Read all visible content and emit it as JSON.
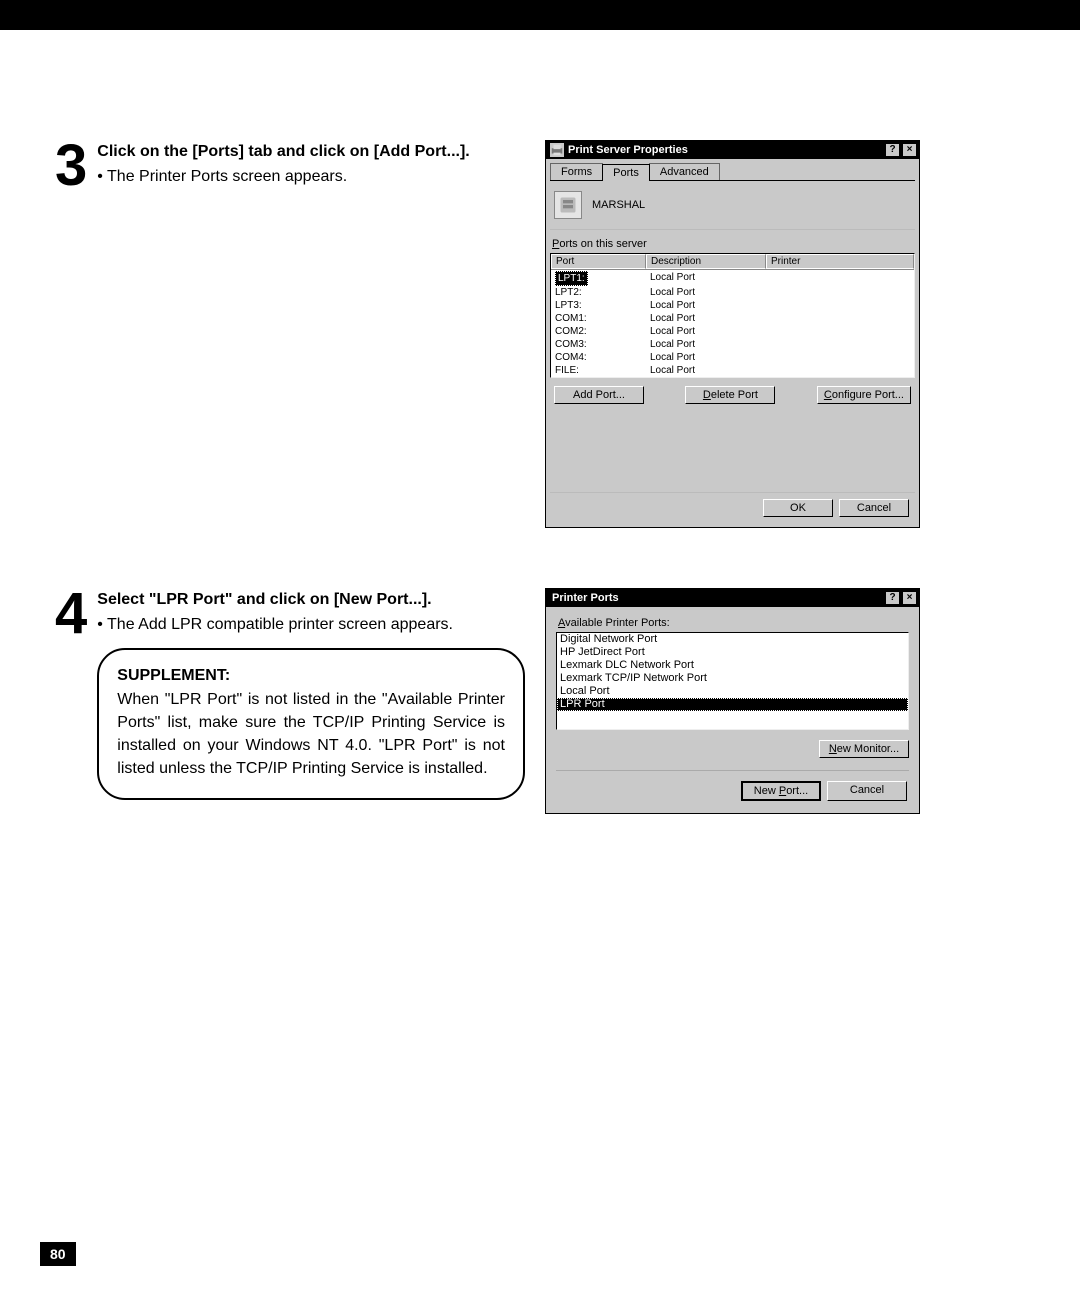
{
  "page_number": "80",
  "step3": {
    "number": "3",
    "title": "Click on the [Ports] tab and click on [Add Port...].",
    "bullet": "The Printer Ports screen appears."
  },
  "step4": {
    "number": "4",
    "title": "Select \"LPR Port\" and click on [New Port...].",
    "bullet": "The Add LPR compatible printer screen appears.",
    "supplement_title": "SUPPLEMENT:",
    "supplement_body": "When \"LPR Port\" is not listed in the \"Available Printer Ports\" list, make sure the TCP/IP Printing Service is installed on your Windows NT 4.0.  \"LPR Port\" is not listed unless the TCP/IP Printing Service is installed."
  },
  "dialog_server": {
    "title": "Print Server Properties",
    "help_btn": "?",
    "close_btn": "×",
    "tabs": {
      "forms": "Forms",
      "ports": "Ports",
      "advanced": "Advanced"
    },
    "server_name": "MARSHAL",
    "list_label_pre": "P",
    "list_label_rest": "orts on this server",
    "col_port": "Port",
    "col_desc": "Description",
    "col_printer": "Printer",
    "rows": [
      {
        "port": "LPT1:",
        "desc": "Local Port",
        "printer": "",
        "selected": true
      },
      {
        "port": "LPT2:",
        "desc": "Local Port",
        "printer": ""
      },
      {
        "port": "LPT3:",
        "desc": "Local Port",
        "printer": ""
      },
      {
        "port": "COM1:",
        "desc": "Local Port",
        "printer": ""
      },
      {
        "port": "COM2:",
        "desc": "Local Port",
        "printer": ""
      },
      {
        "port": "COM3:",
        "desc": "Local Port",
        "printer": ""
      },
      {
        "port": "COM4:",
        "desc": "Local Port",
        "printer": ""
      },
      {
        "port": "FILE:",
        "desc": "Local Port",
        "printer": ""
      }
    ],
    "add_port_btn": "Add Port...",
    "delete_port_btn_pre": "D",
    "delete_port_btn_post": "elete Port",
    "configure_port_btn_pre": "C",
    "configure_port_btn_post": "onfigure Port...",
    "ok_btn": "OK",
    "cancel_btn": "Cancel"
  },
  "dialog_printerports": {
    "title": "Printer Ports",
    "help_btn": "?",
    "close_btn": "×",
    "label_pre": "A",
    "label_rest": "vailable Printer Ports:",
    "items": [
      {
        "text": "Digital Network Port"
      },
      {
        "text": "HP JetDirect Port"
      },
      {
        "text": "Lexmark DLC Network Port"
      },
      {
        "text": "Lexmark TCP/IP Network Port"
      },
      {
        "text": "Local Port"
      },
      {
        "text": "LPR Port",
        "selected": true
      }
    ],
    "new_monitor_btn_pre": "N",
    "new_monitor_btn_post": "ew Monitor...",
    "new_port_btn_pre": "New ",
    "new_port_btn_ul": "P",
    "new_port_btn_post": "ort...",
    "cancel_btn": "Cancel"
  }
}
